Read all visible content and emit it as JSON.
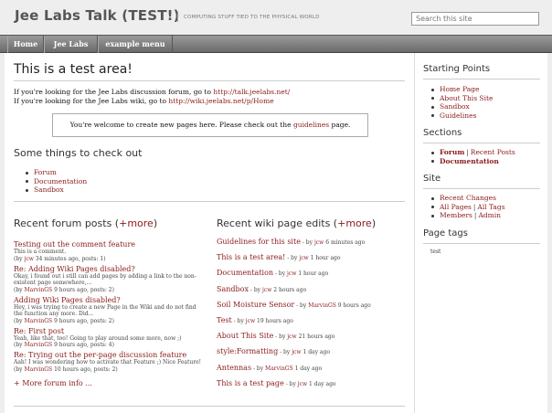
{
  "header": {
    "site_title": "Jee Labs Talk (TEST!)",
    "tagline": "COMPUTING STUFF TIED TO THE PHYSICAL WORLD",
    "search_placeholder": "Search this site"
  },
  "nav": [
    "Home",
    "Jee Labs",
    "example menu"
  ],
  "main": {
    "title": "This is a test area!",
    "intro1_text": "If you're looking for the Jee Labs discussion forum, go to ",
    "intro1_link": "http://talk.jeelabs.net/",
    "intro2_text": "If you're looking for the Jee Labs wiki, go to ",
    "intro2_link": "http://wiki.jeelabs.net/p/Home",
    "notice_text": "You're welcome to create new pages here. Please check out the ",
    "notice_link": "guidelines",
    "notice_end": " page.",
    "check_heading": "Some things to check out",
    "check_items": [
      "Forum",
      "Documentation",
      "Sandbox"
    ]
  },
  "forum": {
    "heading": "Recent forum posts (",
    "more": "+more",
    "close": ")",
    "posts": [
      {
        "title": "Testing out the comment feature",
        "body": "This is a comment.",
        "by": "jcw",
        "meta": "34 minutes ago, posts: 1)"
      },
      {
        "title": "Re: Adding Wiki Pages disabled?",
        "body": "Okay, i found out i still can add pages by adding a link to the non-existent page somewhere,...",
        "by": "MarvinGS",
        "meta": "9 hours ago, posts: 2)"
      },
      {
        "title": "Adding Wiki Pages disabled?",
        "body": "Hey, i was trying to create a new Page in the Wiki and do not find the function any more. Did...",
        "by": "MarvinGS",
        "meta": "9 hours ago, posts: 2)"
      },
      {
        "title": "Re: First post",
        "body": "Yeah, like that, too! Going to play around some more, now ;)",
        "by": "MarvinGS",
        "meta": "9 hours ago, posts: 4)"
      },
      {
        "title": "Re: Trying out the per-page discussion feature",
        "body": "Aah! I was wondering how to activate that Feature ;) Nice Feature!",
        "by": "MarvinGS",
        "meta": "10 hours ago, posts: 2)"
      }
    ],
    "more_info": "+ More forum info ..."
  },
  "wiki": {
    "heading": "Recent wiki page edits (",
    "more": "+more",
    "close": ")",
    "edits": [
      {
        "title": "Guidelines for this site",
        "by": "jcw",
        "meta": "6 minutes ago"
      },
      {
        "title": "This is a test area!",
        "by": "jcw",
        "meta": "1 hour ago"
      },
      {
        "title": "Documentation",
        "by": "jcw",
        "meta": "1 hour ago"
      },
      {
        "title": "Sandbox",
        "by": "jcw",
        "meta": "2 hours ago"
      },
      {
        "title": "Soil Moisture Sensor",
        "by": "MarvinGS",
        "meta": "9 hours ago"
      },
      {
        "title": "Test",
        "by": "jcw",
        "meta": "19 hours ago"
      },
      {
        "title": "About This Site",
        "by": "jcw",
        "meta": "21 hours ago"
      },
      {
        "title": "style:Formatting",
        "by": "jcw",
        "meta": "1 day ago"
      },
      {
        "title": "Antennas",
        "by": "MarvinGS",
        "meta": "1 day ago"
      },
      {
        "title": "This is a test page",
        "by": "jcw",
        "meta": "1 day ago"
      }
    ]
  },
  "sidebar": {
    "starting_heading": "Starting Points",
    "starting_items": [
      "Home Page",
      "About This Site",
      "Sandbox",
      "Guidelines"
    ],
    "sections_heading": "Sections",
    "sections": [
      {
        "a": "Forum",
        "b": "Recent Posts"
      },
      {
        "a": "Documentation",
        "b": ""
      }
    ],
    "site_heading": "Site",
    "site_items": [
      {
        "a": "Recent Changes",
        "b": ""
      },
      {
        "a": "All Pages",
        "b": "All Tags"
      },
      {
        "a": "Members",
        "b": "Admin"
      }
    ],
    "tags_heading": "Page tags",
    "tags": "test"
  },
  "by_prefix": "(by ",
  "wiki_by_prefix": " - by "
}
